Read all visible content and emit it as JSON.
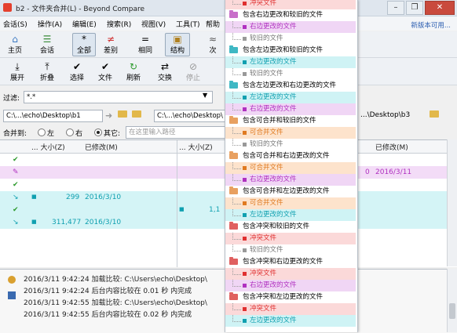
{
  "window": {
    "title": "b2 - 文件夹合并(L) - Beyond Compare",
    "new_version_link": "新版本可用..."
  },
  "menu": [
    "会话(S)",
    "操作(A)",
    "编辑(E)",
    "搜索(R)",
    "视图(V)",
    "工具(T)",
    "帮助"
  ],
  "toolbar1": {
    "home": "主页",
    "sessions": "会话",
    "all": "全部",
    "diffs": "差别",
    "same": "相同",
    "structure": "结构",
    "minor": "次"
  },
  "toolbar2": {
    "expand": "展开",
    "collapse": "折叠",
    "select": "选择",
    "files": "文件",
    "refresh": "刷新",
    "swap": "交换",
    "stop": "停止"
  },
  "filter": {
    "label": "过滤:",
    "value": "*.*"
  },
  "paths": {
    "left": "C:\\...\\echo\\Desktop\\b1",
    "center": "C:\\...\\echo\\Desktop\\",
    "right": "...\\Desktop\\b3"
  },
  "merge": {
    "label": "合并到:",
    "opt_left": "左",
    "opt_right": "右",
    "opt_other": "其它:",
    "placeholder": "在这里输入路径"
  },
  "grid": {
    "headers": {
      "size_left": "大小(Z)",
      "modified_left": "已修改(M)",
      "size_center": "大小(Z)",
      "modified_right": "已修改(M)"
    },
    "rows": [
      {
        "icon": "✔",
        "size": "",
        "date": "",
        "center_size": "",
        "right": ""
      },
      {
        "icon": "✎",
        "size": "",
        "date": "",
        "center_size": "0",
        "right": "2016/3/11"
      },
      {
        "icon": "✔",
        "size": "",
        "date": "",
        "center_size": "",
        "right": ""
      },
      {
        "icon": "↘",
        "size": "299",
        "date": "2016/3/10",
        "center_size": "",
        "right": ""
      },
      {
        "icon": "✔",
        "size": "",
        "date": "",
        "center_size": "1,1",
        "right": ""
      },
      {
        "icon": "↘",
        "size": "311,477",
        "date": "2016/3/10",
        "center_size": "",
        "right": ""
      }
    ]
  },
  "log": [
    "2016/3/11 9:42:24  加载比较: C:\\Users\\echo\\Desktop\\",
    "2016/3/11 9:42:24  后台内容比较在 0.01 秒 内完成",
    "2016/3/11 9:42:55  加载比较: C:\\Users\\echo\\Desktop\\",
    "2016/3/11 9:42:55  后台内容比较在 0.02 秒 内完成"
  ],
  "legend": [
    {
      "kind": "child",
      "label": "冲突文件",
      "color": "#fbd9d9",
      "mark": "#e03030"
    },
    {
      "kind": "folder",
      "label": "包含右边更改和较旧的文件",
      "folder": "#c86fc9"
    },
    {
      "kind": "child",
      "label": "右边更改的文件",
      "color": "#f0d6f5",
      "mark": "#b030c0"
    },
    {
      "kind": "child",
      "label": "较旧的文件",
      "color": "#ffffff",
      "mark": "#999999"
    },
    {
      "kind": "folder",
      "label": "包含左边更改和较旧的文件",
      "folder": "#3fb8c4"
    },
    {
      "kind": "child",
      "label": "左边更改的文件",
      "color": "#cff3f5",
      "mark": "#10a0b0"
    },
    {
      "kind": "child",
      "label": "较旧的文件",
      "color": "#ffffff",
      "mark": "#999999"
    },
    {
      "kind": "folder",
      "label": "包含左边更改和右边更改的文件",
      "folder": "#3fb8c4"
    },
    {
      "kind": "child",
      "label": "左边更改的文件",
      "color": "#cff3f5",
      "mark": "#10a0b0"
    },
    {
      "kind": "child",
      "label": "右边更改的文件",
      "color": "#f0d6f5",
      "mark": "#b030c0"
    },
    {
      "kind": "folder",
      "label": "包含可合并和较旧的文件",
      "folder": "#e8a060"
    },
    {
      "kind": "child",
      "label": "可合并文件",
      "color": "#fde3cc",
      "mark": "#e07a20"
    },
    {
      "kind": "child",
      "label": "较旧的文件",
      "color": "#ffffff",
      "mark": "#999999"
    },
    {
      "kind": "folder",
      "label": "包含可合并和右边更改的文件",
      "folder": "#e8a060"
    },
    {
      "kind": "child",
      "label": "可合并文件",
      "color": "#fde3cc",
      "mark": "#e07a20"
    },
    {
      "kind": "child",
      "label": "右边更改的文件",
      "color": "#f0d6f5",
      "mark": "#b030c0"
    },
    {
      "kind": "folder",
      "label": "包含可合并和左边更改的文件",
      "folder": "#e8a060"
    },
    {
      "kind": "child",
      "label": "可合并文件",
      "color": "#fde3cc",
      "mark": "#e07a20"
    },
    {
      "kind": "child",
      "label": "左边更改的文件",
      "color": "#cff3f5",
      "mark": "#10a0b0"
    },
    {
      "kind": "folder",
      "label": "包含冲突和较旧的文件",
      "folder": "#e06060"
    },
    {
      "kind": "child",
      "label": "冲突文件",
      "color": "#fbd9d9",
      "mark": "#e03030"
    },
    {
      "kind": "child",
      "label": "较旧的文件",
      "color": "#ffffff",
      "mark": "#999999"
    },
    {
      "kind": "folder",
      "label": "包含冲突和右边更改的文件",
      "folder": "#e06060"
    },
    {
      "kind": "child",
      "label": "冲突文件",
      "color": "#fbd9d9",
      "mark": "#e03030"
    },
    {
      "kind": "child",
      "label": "右边更改的文件",
      "color": "#f0d6f5",
      "mark": "#b030c0"
    },
    {
      "kind": "folder",
      "label": "包含冲突和左边更改的文件",
      "folder": "#e06060"
    },
    {
      "kind": "child",
      "label": "冲突文件",
      "color": "#fbd9d9",
      "mark": "#e03030"
    },
    {
      "kind": "child",
      "label": "左边更改的文件",
      "color": "#cff3f5",
      "mark": "#10a0b0"
    }
  ]
}
